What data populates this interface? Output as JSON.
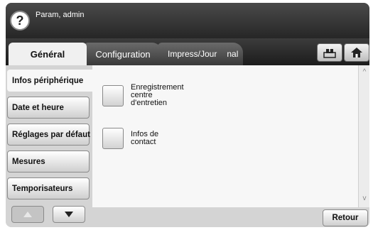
{
  "header": {
    "help_symbol": "?",
    "title": "Param, admin"
  },
  "tabs": [
    {
      "label": "Général"
    },
    {
      "label": "Configuration"
    },
    {
      "label_line1": "Impress/Jour",
      "label_line2": "nal"
    }
  ],
  "toolbar": {
    "job_icon": "job-status-icon",
    "home_icon": "home-icon"
  },
  "sidebar": {
    "items": [
      {
        "label": "Infos périphérique"
      },
      {
        "label": "Date et heure"
      },
      {
        "label": "Réglages par défaut"
      },
      {
        "label": "Mesures"
      },
      {
        "label": "Temporisateurs"
      }
    ]
  },
  "content": {
    "options": [
      {
        "line1": "Enregistrement",
        "line2": "centre",
        "line3": "d'entretien"
      },
      {
        "line1": "Infos de",
        "line2": "contact"
      }
    ]
  },
  "scroll": {
    "up_symbol": "^",
    "down_symbol": "v"
  },
  "footer": {
    "back_label": "Retour"
  }
}
